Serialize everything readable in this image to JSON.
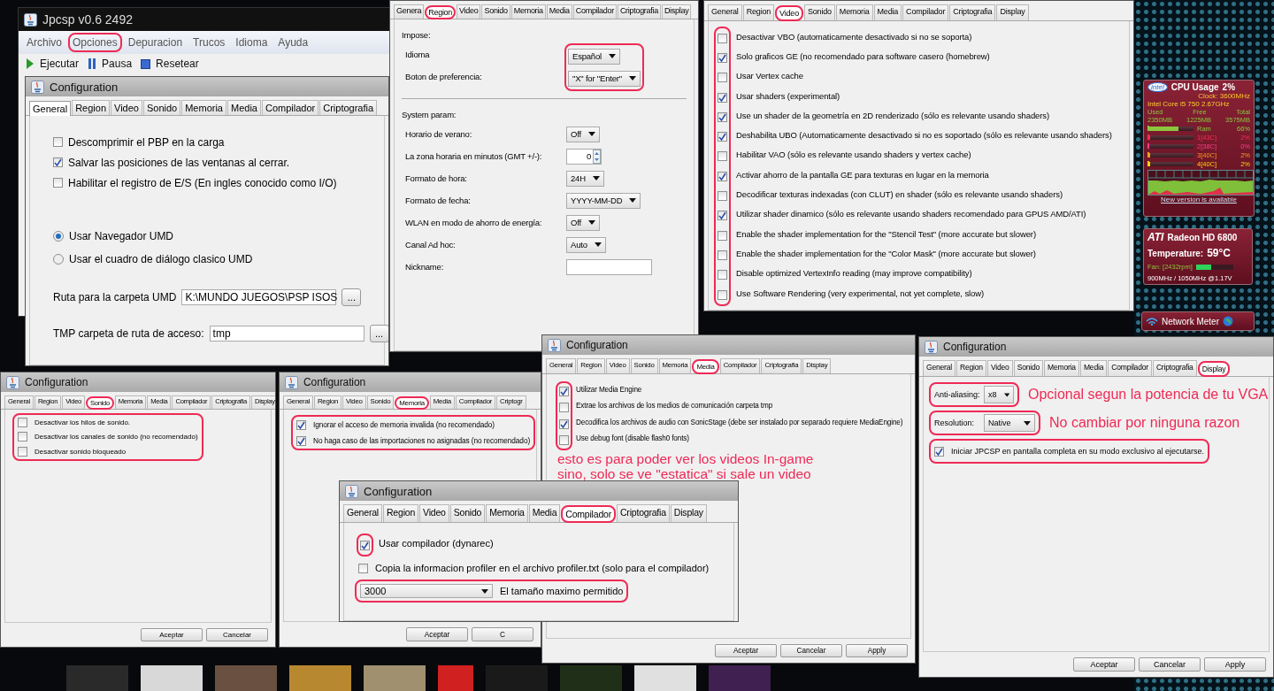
{
  "main_window": {
    "title": "Jpcsp v0.6 2492",
    "menu": [
      {
        "label": "Archivo"
      },
      {
        "label": "Opciones",
        "circled": true
      },
      {
        "label": "Depuracion"
      },
      {
        "label": "Trucos"
      },
      {
        "label": "Idioma"
      },
      {
        "label": "Ayuda"
      }
    ],
    "toolbar": [
      {
        "label": "Ejecutar",
        "kind": "play"
      },
      {
        "label": "Pausa",
        "kind": "pause"
      },
      {
        "label": "Resetear",
        "kind": "stop"
      }
    ]
  },
  "config_windows": [
    {
      "title": "Configuration",
      "tabs": [
        {
          "label": "General",
          "selected": true
        },
        {
          "label": "Region",
          "selected": false
        },
        {
          "label": "Video",
          "selected": false
        },
        {
          "label": "Sonido",
          "selected": false
        },
        {
          "label": "Memoria",
          "selected": false
        },
        {
          "label": "Media",
          "selected": false
        },
        {
          "label": "Compilador",
          "selected": false
        },
        {
          "label": "Criptografia",
          "selected": false
        }
      ],
      "content": [
        {
          "items": [
            {
              "kind": "checkbox",
              "label": "Descomprimir el PBP en la carga",
              "checked": false
            },
            {
              "kind": "checkbox",
              "label": "Salvar las posiciones de las ventanas al cerrar.",
              "checked": true
            },
            {
              "kind": "checkbox",
              "label": "Habilitar el registro de E/S (En ingles conocido como I/O)",
              "checked": false
            }
          ]
        },
        {
          "items": [
            {
              "kind": "radio",
              "label": "Usar Navegador UMD",
              "selected": true
            },
            {
              "kind": "radio",
              "label": "Usar el cuadro de diálogo clasico UMD",
              "selected": false
            }
          ]
        },
        {
          "items": [
            {
              "kind": "path",
              "label": "Ruta para la carpeta UMD",
              "value": "K:\\MUNDO JUEGOS\\PSP ISOS",
              "button": "..."
            }
          ]
        },
        {
          "items": [
            {
              "kind": "path",
              "label": "TMP carpeta de ruta de acceso:",
              "value": "tmp",
              "button": "..."
            }
          ]
        }
      ]
    },
    {
      "tabs": [
        {
          "label": "Genera",
          "selected": false
        },
        {
          "label": "Region",
          "selected": true,
          "circled": true
        },
        {
          "label": "Video",
          "selected": false
        },
        {
          "label": "Sonido",
          "selected": false
        },
        {
          "label": "Memoria",
          "selected": false
        },
        {
          "label": "Media",
          "selected": false
        },
        {
          "label": "Compilador",
          "selected": false
        },
        {
          "label": "Criptografia",
          "selected": false
        },
        {
          "label": "Display",
          "selected": false
        }
      ],
      "content": [
        {
          "heading": "Impose:",
          "controls_circled": true,
          "items": [
            {
              "kind": "select",
              "label": "Idioma",
              "value": "Español"
            },
            {
              "kind": "select",
              "label": "Boton de preferencia:",
              "value": "\"X\" for \"Enter\""
            }
          ]
        },
        {
          "divider_before": true,
          "heading": "System param:",
          "items": [
            {
              "kind": "select",
              "label": "Horario de verano:",
              "value": "Off"
            },
            {
              "kind": "spinner",
              "label": "La zona horaria en minutos (GMT +/-):",
              "value": "0"
            },
            {
              "kind": "select",
              "label": "Formato de hora:",
              "value": "24H"
            },
            {
              "kind": "select",
              "label": "Formato de fecha:",
              "value": "YYYY-MM-DD"
            },
            {
              "kind": "select",
              "label": "WLAN en modo de ahorro de energía:",
              "value": "Off"
            },
            {
              "kind": "select",
              "label": "Canal Ad hoc:",
              "value": "Auto"
            },
            {
              "kind": "field",
              "label": "Nickname:"
            }
          ]
        }
      ]
    },
    {
      "tabs": [
        {
          "label": "General",
          "selected": false
        },
        {
          "label": "Region",
          "selected": false
        },
        {
          "label": "Video",
          "selected": true,
          "circled": true
        },
        {
          "label": "Sonido",
          "selected": false
        },
        {
          "label": "Memoria",
          "selected": false
        },
        {
          "label": "Media",
          "selected": false
        },
        {
          "label": "Compilador",
          "selected": false
        },
        {
          "label": "Criptografia",
          "selected": false
        },
        {
          "label": "Display",
          "selected": false
        }
      ],
      "content": [
        {
          "lead_circled": true,
          "items": [
            {
              "kind": "checkbox",
              "label": "Desactivar VBO (automaticamente desactivado si no se soporta)",
              "checked": false
            },
            {
              "kind": "checkbox",
              "label": "Solo graficos GE (no recomendado para software casero (homebrew)",
              "checked": true
            },
            {
              "kind": "checkbox",
              "label": "Usar Vertex cache",
              "checked": false
            },
            {
              "kind": "checkbox",
              "label": "Usar shaders (experimental)",
              "checked": true
            },
            {
              "kind": "checkbox",
              "label": "Use un shader de la geometría en 2D renderizado (sólo es relevante usando shaders)",
              "checked": true
            },
            {
              "kind": "checkbox",
              "label": "Deshabilita UBO (Automaticamente desactivado si no es soportado (sólo es relevante usando shaders)",
              "checked": true
            },
            {
              "kind": "checkbox",
              "label": "Habilitar VAO (sólo es relevante usando shaders y vertex cache)",
              "checked": false
            },
            {
              "kind": "checkbox",
              "label": "Activar ahorro de la pantalla GE para texturas en lugar en la memoria",
              "checked": true
            },
            {
              "kind": "checkbox",
              "label": "Decodificar texturas indexadas (con CLUT) en shader (sólo es relevante usando shaders)",
              "checked": false
            },
            {
              "kind": "checkbox",
              "label": "Utilizar shader dinamico (sólo es relevante usando shaders recomendado para GPUS AMD/ATI)",
              "checked": true
            },
            {
              "kind": "checkbox",
              "label": "Enable the shader implementation for the \"Stencil Test\" (more accurate but slower)",
              "checked": false
            },
            {
              "kind": "checkbox",
              "label": "Enable the shader implementation for the \"Color Mask\" (more accurate but slower)",
              "checked": false
            },
            {
              "kind": "checkbox",
              "label": "Disable optimized VertexInfo reading (may improve compatibility)",
              "checked": false
            },
            {
              "kind": "checkbox",
              "label": "Use Software Rendering (very experimental, not yet complete, slow)",
              "checked": false
            }
          ]
        }
      ]
    },
    {
      "title": "Configuration",
      "tabs": [
        {
          "label": "General",
          "selected": false
        },
        {
          "label": "Region",
          "selected": false
        },
        {
          "label": "Video",
          "selected": false
        },
        {
          "label": "Sonido",
          "selected": true,
          "circled": true
        },
        {
          "label": "Memoria",
          "selected": false
        },
        {
          "label": "Media",
          "selected": false
        },
        {
          "label": "Compilador",
          "selected": false
        },
        {
          "label": "Criptografia",
          "selected": false
        },
        {
          "label": "Display",
          "selected": false
        }
      ],
      "content": [
        {
          "circled": true,
          "items": [
            {
              "kind": "checkbox",
              "label": "Desactivar los hilos de sonido.",
              "checked": false
            },
            {
              "kind": "checkbox",
              "label": "Desactivar los canales de sonido (no recomendado)",
              "checked": false
            },
            {
              "kind": "checkbox",
              "label": "Desactivar sonido bloqueado",
              "checked": false
            }
          ]
        }
      ],
      "buttons": [
        "Aceptar",
        "Cancelar"
      ]
    },
    {
      "title": "Configuration",
      "tabs": [
        {
          "label": "General",
          "selected": false
        },
        {
          "label": "Region",
          "selected": false
        },
        {
          "label": "Video",
          "selected": false
        },
        {
          "label": "Sonido",
          "selected": false
        },
        {
          "label": "Memoria",
          "selected": true,
          "circled": true
        },
        {
          "label": "Media",
          "selected": false
        },
        {
          "label": "Compilador",
          "selected": false
        },
        {
          "label": "Criptogr",
          "selected": false
        }
      ],
      "content": [
        {
          "circled": true,
          "items": [
            {
              "kind": "checkbox",
              "label": "Ignorar el acceso de memoria invalida (no recomendado)",
              "checked": true
            },
            {
              "kind": "checkbox",
              "label": "No haga caso de las importaciones no asignadas (no recomendado)",
              "checked": true
            }
          ]
        }
      ],
      "buttons": [
        "Aceptar",
        "C"
      ]
    },
    {
      "title": "Configuration",
      "tabs": [
        {
          "label": "General",
          "selected": false
        },
        {
          "label": "Region",
          "selected": false
        },
        {
          "label": "Video",
          "selected": false
        },
        {
          "label": "Sonido",
          "selected": false
        },
        {
          "label": "Memoria",
          "selected": false
        },
        {
          "label": "Media",
          "selected": true,
          "circled": true
        },
        {
          "label": "Compilador",
          "selected": false
        },
        {
          "label": "Criptografia",
          "selected": false
        },
        {
          "label": "Display",
          "selected": false
        }
      ],
      "content": [
        {
          "lead_circled": true,
          "items": [
            {
              "kind": "checkbox",
              "label": "Utilizar Media Engine",
              "checked": true
            },
            {
              "kind": "checkbox",
              "label": "Extrae los archivos de los medios de comunicación carpeta tmp",
              "checked": false
            },
            {
              "kind": "checkbox",
              "label": "Decodifica los archivos de audio con SonicStage (debe ser instalado por separado requiere MediaEngine)",
              "checked": true
            },
            {
              "kind": "checkbox",
              "label": "Use debug font (disable flash0 fonts)",
              "checked": false
            }
          ]
        }
      ],
      "annotation": [
        "esto es para poder ver los videos In-game",
        "sino, solo se ve \"estatica\" si sale un video"
      ],
      "buttons": [
        "Aceptar",
        "Cancelar",
        "Apply"
      ]
    },
    {
      "title": "Configuration",
      "tabs": [
        {
          "label": "General",
          "selected": false
        },
        {
          "label": "Region",
          "selected": false
        },
        {
          "label": "Video",
          "selected": false
        },
        {
          "label": "Sonido",
          "selected": false
        },
        {
          "label": "Memoria",
          "selected": false
        },
        {
          "label": "Media",
          "selected": false
        },
        {
          "label": "Compilador",
          "selected": true,
          "circled": true
        },
        {
          "label": "Criptografia",
          "selected": false
        },
        {
          "label": "Display",
          "selected": false
        }
      ],
      "content": [
        {
          "lead_circled": true,
          "items": [
            {
              "kind": "checkbox",
              "label": "Usar compilador (dynarec)",
              "checked": true
            }
          ]
        },
        {
          "items": [
            {
              "kind": "checkbox",
              "label": "Copia la informacion profiler en el archivo profiler.txt (solo para el compilador)",
              "checked": false
            }
          ]
        },
        {
          "circled": true,
          "items": [
            {
              "kind": "combo",
              "value": "3000",
              "caption": "El tamaño maximo permitido"
            }
          ]
        }
      ]
    },
    {
      "title": "Configuration",
      "tabs": [
        {
          "label": "General",
          "selected": false
        },
        {
          "label": "Region",
          "selected": false
        },
        {
          "label": "Video",
          "selected": false
        },
        {
          "label": "Sonido",
          "selected": false
        },
        {
          "label": "Memoria",
          "selected": false
        },
        {
          "label": "Media",
          "selected": false
        },
        {
          "label": "Compilador",
          "selected": false
        },
        {
          "label": "Criptografia",
          "selected": false
        },
        {
          "label": "Display",
          "selected": true,
          "circled": true
        }
      ],
      "content": [
        {
          "circled": true,
          "items": [
            {
              "kind": "select",
              "label": "Anti-aliasing:",
              "value": "x8"
            }
          ],
          "note": "Opcional segun la potencia de tu VGA"
        },
        {
          "circled": true,
          "items": [
            {
              "kind": "select",
              "label": "Resolution:",
              "value": "Native"
            }
          ],
          "note": "No cambiar por ninguna razon"
        },
        {
          "circled": true,
          "items": [
            {
              "kind": "checkbox",
              "label": "Iniciar JPCSP en pantalla completa en su modo exclusivo al ejecutarse.",
              "checked": true
            }
          ]
        }
      ],
      "buttons": [
        "Aceptar",
        "Cancelar",
        "Apply"
      ]
    }
  ],
  "cpu_gadget": {
    "logo": "intel",
    "title": "CPU Usage",
    "usage": "2%",
    "clock": "Clock: 3600MHz",
    "cpu_name": "Intel Core i5 750 2.67GHz",
    "memory_headers": [
      "Used",
      "Free",
      "Total"
    ],
    "memory_values": [
      "2350MB",
      "1225MB",
      "3575MB"
    ],
    "meters": [
      {
        "label": "Ram",
        "reading": "66%",
        "level": 0.66,
        "color": "#8cc63f"
      },
      {
        "label": "1[43C]",
        "reading": "2%",
        "level": 0.02,
        "color": "#ff2a55"
      },
      {
        "label": "2[38C]",
        "reading": "0%",
        "level": 0.0,
        "color": "#ff3d8b"
      },
      {
        "label": "3[40C]",
        "reading": "2%",
        "level": 0.02,
        "color": "#ff9a1f"
      },
      {
        "label": "4[40C]",
        "reading": "2%",
        "level": 0.02,
        "color": "#ffd400"
      }
    ],
    "link": "New version is available"
  },
  "gpu_gadget": {
    "logo": "ATI",
    "model": "Radeon HD 6800",
    "temperature_label": "Temperature:",
    "temperature": "59°C",
    "fan": {
      "label": "Fan: [2432rpm]",
      "level": 0.4
    },
    "clocks": "900MHz / 1050MHz @1.17V"
  },
  "network_gadget": {
    "title": "Network Meter"
  }
}
